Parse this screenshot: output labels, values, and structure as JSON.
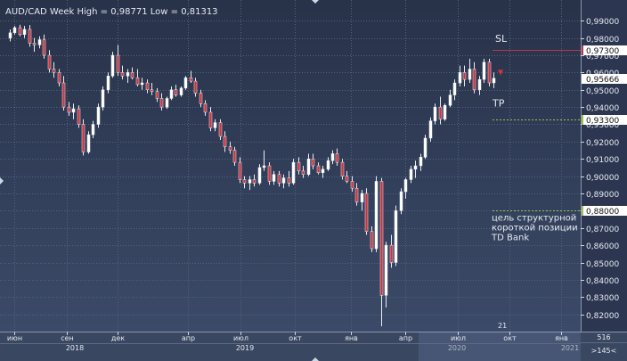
{
  "chart_data": {
    "type": "candlestick",
    "title": "AUD/CAD Week High = 0,98771 Low = 0,81313",
    "ylim": [
      0.81,
      1.002
    ],
    "y_ticks": [
      "0,99000",
      "0,98000",
      "0,97000",
      "0,96000",
      "0,95000",
      "0,94000",
      "0,93000",
      "0,92000",
      "0,91000",
      "0,90000",
      "0,89000",
      "0,88000",
      "0,87000",
      "0,86000",
      "0,85000",
      "0,84000",
      "0,83000",
      "0,82000"
    ],
    "x_month_labels": [
      "июн",
      "сен",
      "дек",
      "апр",
      "июл",
      "окт",
      "янв",
      "апр",
      "июл",
      "окт",
      "янв"
    ],
    "x_year_labels": [
      "2018",
      "2019",
      "2020",
      "2021"
    ],
    "levels": [
      {
        "name": "SL",
        "value": 0.973,
        "label": "0,97300",
        "color": "#b03a48"
      },
      {
        "name": "TP",
        "value": 0.933,
        "label": "0,93300",
        "color": "#9ec04a"
      },
      {
        "name": "target",
        "value": 0.88,
        "label": "0,88000",
        "color": "#9ec04a"
      }
    ],
    "current_price": {
      "value": 0.9567,
      "label": "0,95666"
    },
    "annotations": {
      "sl": "SL",
      "tp": "TP",
      "target_text": [
        "цель структурной",
        "короткой позиции",
        "TD Bank"
      ],
      "bottom_marker": "21"
    },
    "corner_labels": {
      "top": "516",
      "bottom": ">145<"
    },
    "candles": [
      {
        "o": 0.98,
        "h": 0.985,
        "l": 0.978,
        "c": 0.983
      },
      {
        "o": 0.983,
        "h": 0.987,
        "l": 0.982,
        "c": 0.986
      },
      {
        "o": 0.986,
        "h": 0.9877,
        "l": 0.981,
        "c": 0.982
      },
      {
        "o": 0.982,
        "h": 0.987,
        "l": 0.98,
        "c": 0.985
      },
      {
        "o": 0.985,
        "h": 0.9875,
        "l": 0.975,
        "c": 0.977
      },
      {
        "o": 0.977,
        "h": 0.98,
        "l": 0.972,
        "c": 0.976
      },
      {
        "o": 0.976,
        "h": 0.981,
        "l": 0.974,
        "c": 0.979
      },
      {
        "o": 0.979,
        "h": 0.982,
        "l": 0.968,
        "c": 0.97
      },
      {
        "o": 0.97,
        "h": 0.973,
        "l": 0.96,
        "c": 0.962
      },
      {
        "o": 0.962,
        "h": 0.966,
        "l": 0.957,
        "c": 0.96
      },
      {
        "o": 0.96,
        "h": 0.962,
        "l": 0.952,
        "c": 0.954
      },
      {
        "o": 0.954,
        "h": 0.958,
        "l": 0.938,
        "c": 0.94
      },
      {
        "o": 0.94,
        "h": 0.943,
        "l": 0.935,
        "c": 0.937
      },
      {
        "o": 0.937,
        "h": 0.942,
        "l": 0.933,
        "c": 0.939
      },
      {
        "o": 0.939,
        "h": 0.941,
        "l": 0.928,
        "c": 0.93
      },
      {
        "o": 0.93,
        "h": 0.933,
        "l": 0.912,
        "c": 0.914
      },
      {
        "o": 0.914,
        "h": 0.926,
        "l": 0.913,
        "c": 0.924
      },
      {
        "o": 0.924,
        "h": 0.932,
        "l": 0.922,
        "c": 0.93
      },
      {
        "o": 0.93,
        "h": 0.942,
        "l": 0.928,
        "c": 0.94
      },
      {
        "o": 0.94,
        "h": 0.952,
        "l": 0.938,
        "c": 0.95
      },
      {
        "o": 0.95,
        "h": 0.96,
        "l": 0.948,
        "c": 0.958
      },
      {
        "o": 0.958,
        "h": 0.972,
        "l": 0.957,
        "c": 0.97
      },
      {
        "o": 0.97,
        "h": 0.976,
        "l": 0.958,
        "c": 0.96
      },
      {
        "o": 0.96,
        "h": 0.964,
        "l": 0.956,
        "c": 0.958
      },
      {
        "o": 0.958,
        "h": 0.962,
        "l": 0.954,
        "c": 0.96
      },
      {
        "o": 0.96,
        "h": 0.963,
        "l": 0.956,
        "c": 0.957
      },
      {
        "o": 0.957,
        "h": 0.962,
        "l": 0.952,
        "c": 0.953
      },
      {
        "o": 0.953,
        "h": 0.957,
        "l": 0.95,
        "c": 0.954
      },
      {
        "o": 0.954,
        "h": 0.956,
        "l": 0.948,
        "c": 0.95
      },
      {
        "o": 0.95,
        "h": 0.954,
        "l": 0.947,
        "c": 0.949
      },
      {
        "o": 0.949,
        "h": 0.951,
        "l": 0.943,
        "c": 0.945
      },
      {
        "o": 0.945,
        "h": 0.948,
        "l": 0.938,
        "c": 0.94
      },
      {
        "o": 0.94,
        "h": 0.946,
        "l": 0.939,
        "c": 0.945
      },
      {
        "o": 0.945,
        "h": 0.952,
        "l": 0.944,
        "c": 0.95
      },
      {
        "o": 0.95,
        "h": 0.953,
        "l": 0.946,
        "c": 0.947
      },
      {
        "o": 0.947,
        "h": 0.952,
        "l": 0.946,
        "c": 0.951
      },
      {
        "o": 0.951,
        "h": 0.958,
        "l": 0.95,
        "c": 0.957
      },
      {
        "o": 0.957,
        "h": 0.961,
        "l": 0.954,
        "c": 0.955
      },
      {
        "o": 0.955,
        "h": 0.957,
        "l": 0.946,
        "c": 0.948
      },
      {
        "o": 0.948,
        "h": 0.95,
        "l": 0.94,
        "c": 0.942
      },
      {
        "o": 0.942,
        "h": 0.944,
        "l": 0.935,
        "c": 0.937
      },
      {
        "o": 0.937,
        "h": 0.94,
        "l": 0.926,
        "c": 0.928
      },
      {
        "o": 0.928,
        "h": 0.933,
        "l": 0.926,
        "c": 0.931
      },
      {
        "o": 0.931,
        "h": 0.933,
        "l": 0.921,
        "c": 0.923
      },
      {
        "o": 0.923,
        "h": 0.926,
        "l": 0.914,
        "c": 0.917
      },
      {
        "o": 0.917,
        "h": 0.92,
        "l": 0.913,
        "c": 0.915
      },
      {
        "o": 0.915,
        "h": 0.917,
        "l": 0.906,
        "c": 0.908
      },
      {
        "o": 0.908,
        "h": 0.911,
        "l": 0.896,
        "c": 0.898
      },
      {
        "o": 0.898,
        "h": 0.9,
        "l": 0.893,
        "c": 0.896
      },
      {
        "o": 0.896,
        "h": 0.9,
        "l": 0.892,
        "c": 0.898
      },
      {
        "o": 0.898,
        "h": 0.901,
        "l": 0.894,
        "c": 0.896
      },
      {
        "o": 0.896,
        "h": 0.907,
        "l": 0.895,
        "c": 0.905
      },
      {
        "o": 0.905,
        "h": 0.915,
        "l": 0.903,
        "c": 0.906
      },
      {
        "o": 0.906,
        "h": 0.908,
        "l": 0.895,
        "c": 0.897
      },
      {
        "o": 0.897,
        "h": 0.903,
        "l": 0.895,
        "c": 0.901
      },
      {
        "o": 0.901,
        "h": 0.903,
        "l": 0.894,
        "c": 0.896
      },
      {
        "o": 0.896,
        "h": 0.901,
        "l": 0.893,
        "c": 0.899
      },
      {
        "o": 0.899,
        "h": 0.903,
        "l": 0.894,
        "c": 0.896
      },
      {
        "o": 0.896,
        "h": 0.91,
        "l": 0.895,
        "c": 0.908
      },
      {
        "o": 0.908,
        "h": 0.911,
        "l": 0.901,
        "c": 0.903
      },
      {
        "o": 0.903,
        "h": 0.906,
        "l": 0.899,
        "c": 0.901
      },
      {
        "o": 0.901,
        "h": 0.913,
        "l": 0.9,
        "c": 0.91
      },
      {
        "o": 0.91,
        "h": 0.913,
        "l": 0.904,
        "c": 0.906
      },
      {
        "o": 0.906,
        "h": 0.908,
        "l": 0.901,
        "c": 0.902
      },
      {
        "o": 0.902,
        "h": 0.906,
        "l": 0.899,
        "c": 0.904
      },
      {
        "o": 0.904,
        "h": 0.911,
        "l": 0.903,
        "c": 0.909
      },
      {
        "o": 0.909,
        "h": 0.915,
        "l": 0.907,
        "c": 0.913
      },
      {
        "o": 0.913,
        "h": 0.916,
        "l": 0.906,
        "c": 0.908
      },
      {
        "o": 0.908,
        "h": 0.91,
        "l": 0.898,
        "c": 0.9
      },
      {
        "o": 0.9,
        "h": 0.903,
        "l": 0.896,
        "c": 0.897
      },
      {
        "o": 0.897,
        "h": 0.9,
        "l": 0.891,
        "c": 0.893
      },
      {
        "o": 0.893,
        "h": 0.896,
        "l": 0.883,
        "c": 0.885
      },
      {
        "o": 0.885,
        "h": 0.892,
        "l": 0.88,
        "c": 0.89
      },
      {
        "o": 0.89,
        "h": 0.893,
        "l": 0.866,
        "c": 0.868
      },
      {
        "o": 0.868,
        "h": 0.871,
        "l": 0.856,
        "c": 0.858
      },
      {
        "o": 0.858,
        "h": 0.9,
        "l": 0.856,
        "c": 0.897
      },
      {
        "o": 0.897,
        "h": 0.899,
        "l": 0.8131,
        "c": 0.831
      },
      {
        "o": 0.831,
        "h": 0.862,
        "l": 0.824,
        "c": 0.86
      },
      {
        "o": 0.86,
        "h": 0.866,
        "l": 0.847,
        "c": 0.85
      },
      {
        "o": 0.85,
        "h": 0.883,
        "l": 0.848,
        "c": 0.88
      },
      {
        "o": 0.88,
        "h": 0.893,
        "l": 0.878,
        "c": 0.891
      },
      {
        "o": 0.891,
        "h": 0.899,
        "l": 0.887,
        "c": 0.898
      },
      {
        "o": 0.898,
        "h": 0.906,
        "l": 0.896,
        "c": 0.904
      },
      {
        "o": 0.904,
        "h": 0.909,
        "l": 0.899,
        "c": 0.906
      },
      {
        "o": 0.906,
        "h": 0.913,
        "l": 0.903,
        "c": 0.911
      },
      {
        "o": 0.911,
        "h": 0.924,
        "l": 0.91,
        "c": 0.922
      },
      {
        "o": 0.922,
        "h": 0.934,
        "l": 0.92,
        "c": 0.932
      },
      {
        "o": 0.932,
        "h": 0.942,
        "l": 0.93,
        "c": 0.94
      },
      {
        "o": 0.94,
        "h": 0.946,
        "l": 0.93,
        "c": 0.933
      },
      {
        "o": 0.933,
        "h": 0.942,
        "l": 0.932,
        "c": 0.941
      },
      {
        "o": 0.941,
        "h": 0.95,
        "l": 0.94,
        "c": 0.947
      },
      {
        "o": 0.947,
        "h": 0.956,
        "l": 0.944,
        "c": 0.954
      },
      {
        "o": 0.954,
        "h": 0.964,
        "l": 0.952,
        "c": 0.96
      },
      {
        "o": 0.96,
        "h": 0.964,
        "l": 0.952,
        "c": 0.956
      },
      {
        "o": 0.956,
        "h": 0.968,
        "l": 0.954,
        "c": 0.962
      },
      {
        "o": 0.962,
        "h": 0.966,
        "l": 0.948,
        "c": 0.95
      },
      {
        "o": 0.95,
        "h": 0.958,
        "l": 0.947,
        "c": 0.956
      },
      {
        "o": 0.956,
        "h": 0.968,
        "l": 0.954,
        "c": 0.966
      },
      {
        "o": 0.966,
        "h": 0.968,
        "l": 0.952,
        "c": 0.954
      },
      {
        "o": 0.954,
        "h": 0.96,
        "l": 0.951,
        "c": 0.9567
      }
    ]
  }
}
